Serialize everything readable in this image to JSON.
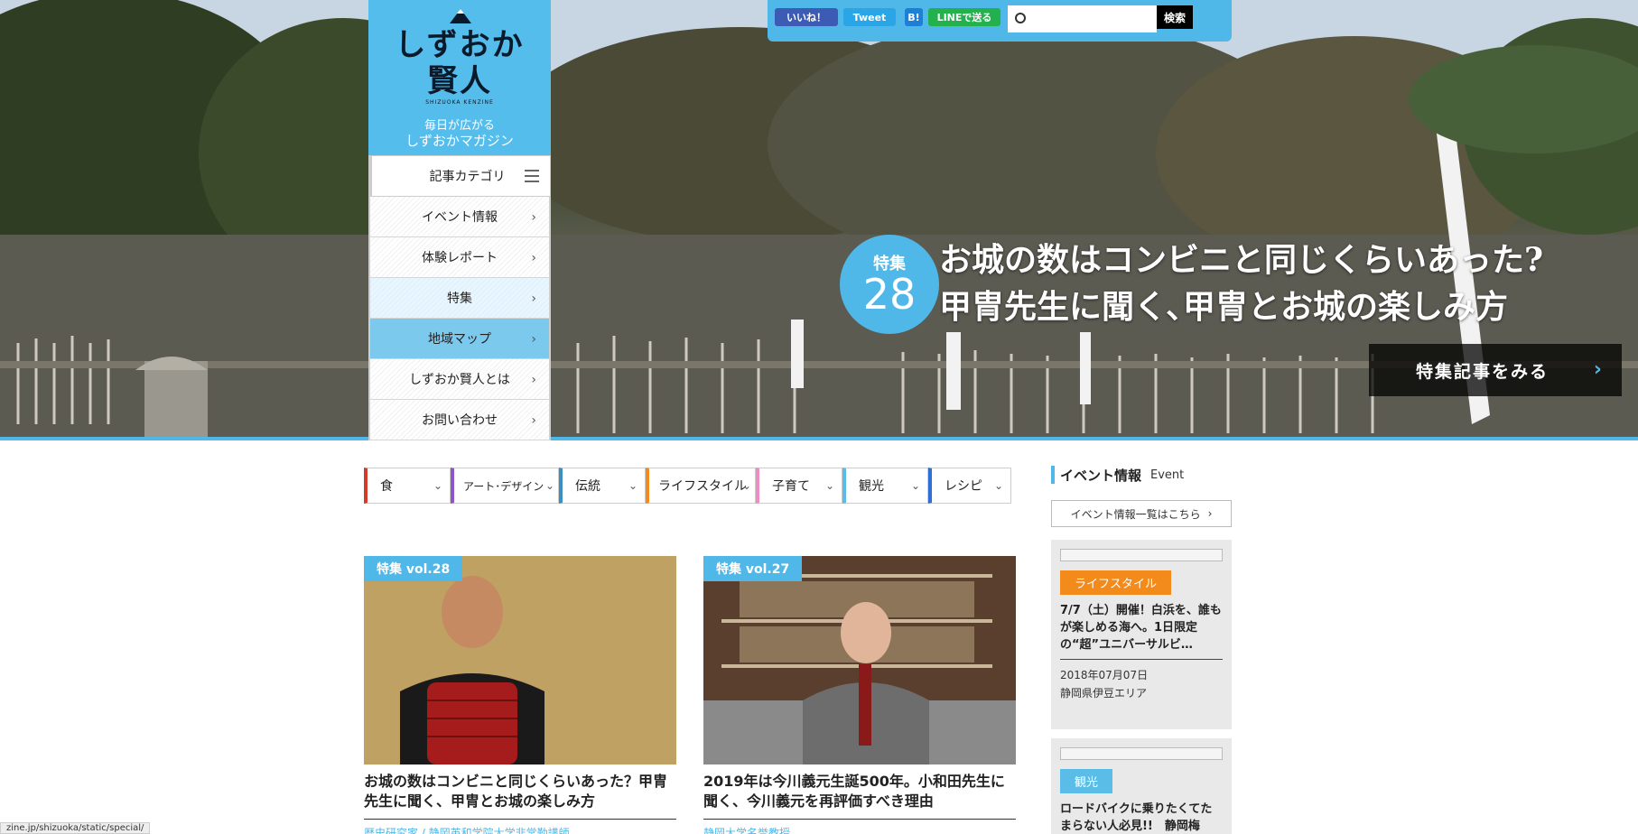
{
  "share": {
    "like_label": "いいね！",
    "tweet_label": "Tweet",
    "hatena_label": "B!",
    "line_label": "LINEで送る",
    "search_placeholder": "",
    "search_button": "検索"
  },
  "logo": {
    "title_line1": "しずおか",
    "title_line2": "賢人",
    "sub": "SHIZUOKA KENZINE",
    "tagline1": "毎日が広がる",
    "tagline2": "しずおかマガジン"
  },
  "nav": {
    "category": "記事カテゴリ",
    "items": [
      {
        "label": "イベント情報"
      },
      {
        "label": "体験レポート"
      },
      {
        "label": "特集"
      },
      {
        "label": "地域マップ"
      },
      {
        "label": "しずおか賢人とは"
      },
      {
        "label": "お問い合わせ"
      }
    ]
  },
  "feature": {
    "badge_label": "特集",
    "badge_number": "28",
    "title_line1": "お城の数はコンビニと同じくらいあった?",
    "title_line2": "甲冑先生に聞く､甲冑とお城の楽しみ方",
    "cta": "特集記事をみる"
  },
  "categories": [
    {
      "label": "食",
      "color": "#d23a2a"
    },
    {
      "label": "アート･デザイン",
      "color": "#8e55c9"
    },
    {
      "label": "伝統",
      "color": "#3e8fbf"
    },
    {
      "label": "ライフスタイル",
      "color": "#f28a1c"
    },
    {
      "label": "子育て",
      "color": "#f08bc6"
    },
    {
      "label": "観光",
      "color": "#5abde8"
    },
    {
      "label": "レシピ",
      "color": "#2d6fd6"
    }
  ],
  "cards": [
    {
      "tag": "特集 vol.28",
      "title": "お城の数はコンビニと同じくらいあった？甲冑先生に聞く、甲冑とお城の楽しみ方",
      "sub": "歴史研究家 / 静岡英和学院大学非常勤講師"
    },
    {
      "tag": "特集 vol.27",
      "title": "2019年は今川義元生誕500年。小和田先生に聞く、今川義元を再評価すべき理由",
      "sub": "静岡大学名誉教授"
    }
  ],
  "events": {
    "heading": "イベント情報",
    "heading_en": "Event",
    "list_button": "イベント情報一覧はこちら",
    "items": [
      {
        "badge": "ライフスタイル",
        "badge_color": "#f28a1c",
        "title": "7/7（土）開催！白浜を、誰もが楽しめる海へ。1日限定の“超”ユニバーサルビ…",
        "date": "2018年07月07日",
        "area": "静岡県伊豆エリア"
      },
      {
        "badge": "観光",
        "badge_color": "#5abde8",
        "title": "ロードバイクに乗りたくてたまらない人必見!!　静岡梅",
        "date": "",
        "area": ""
      }
    ]
  },
  "status_url": "zine.jp/shizuoka/static/special/"
}
